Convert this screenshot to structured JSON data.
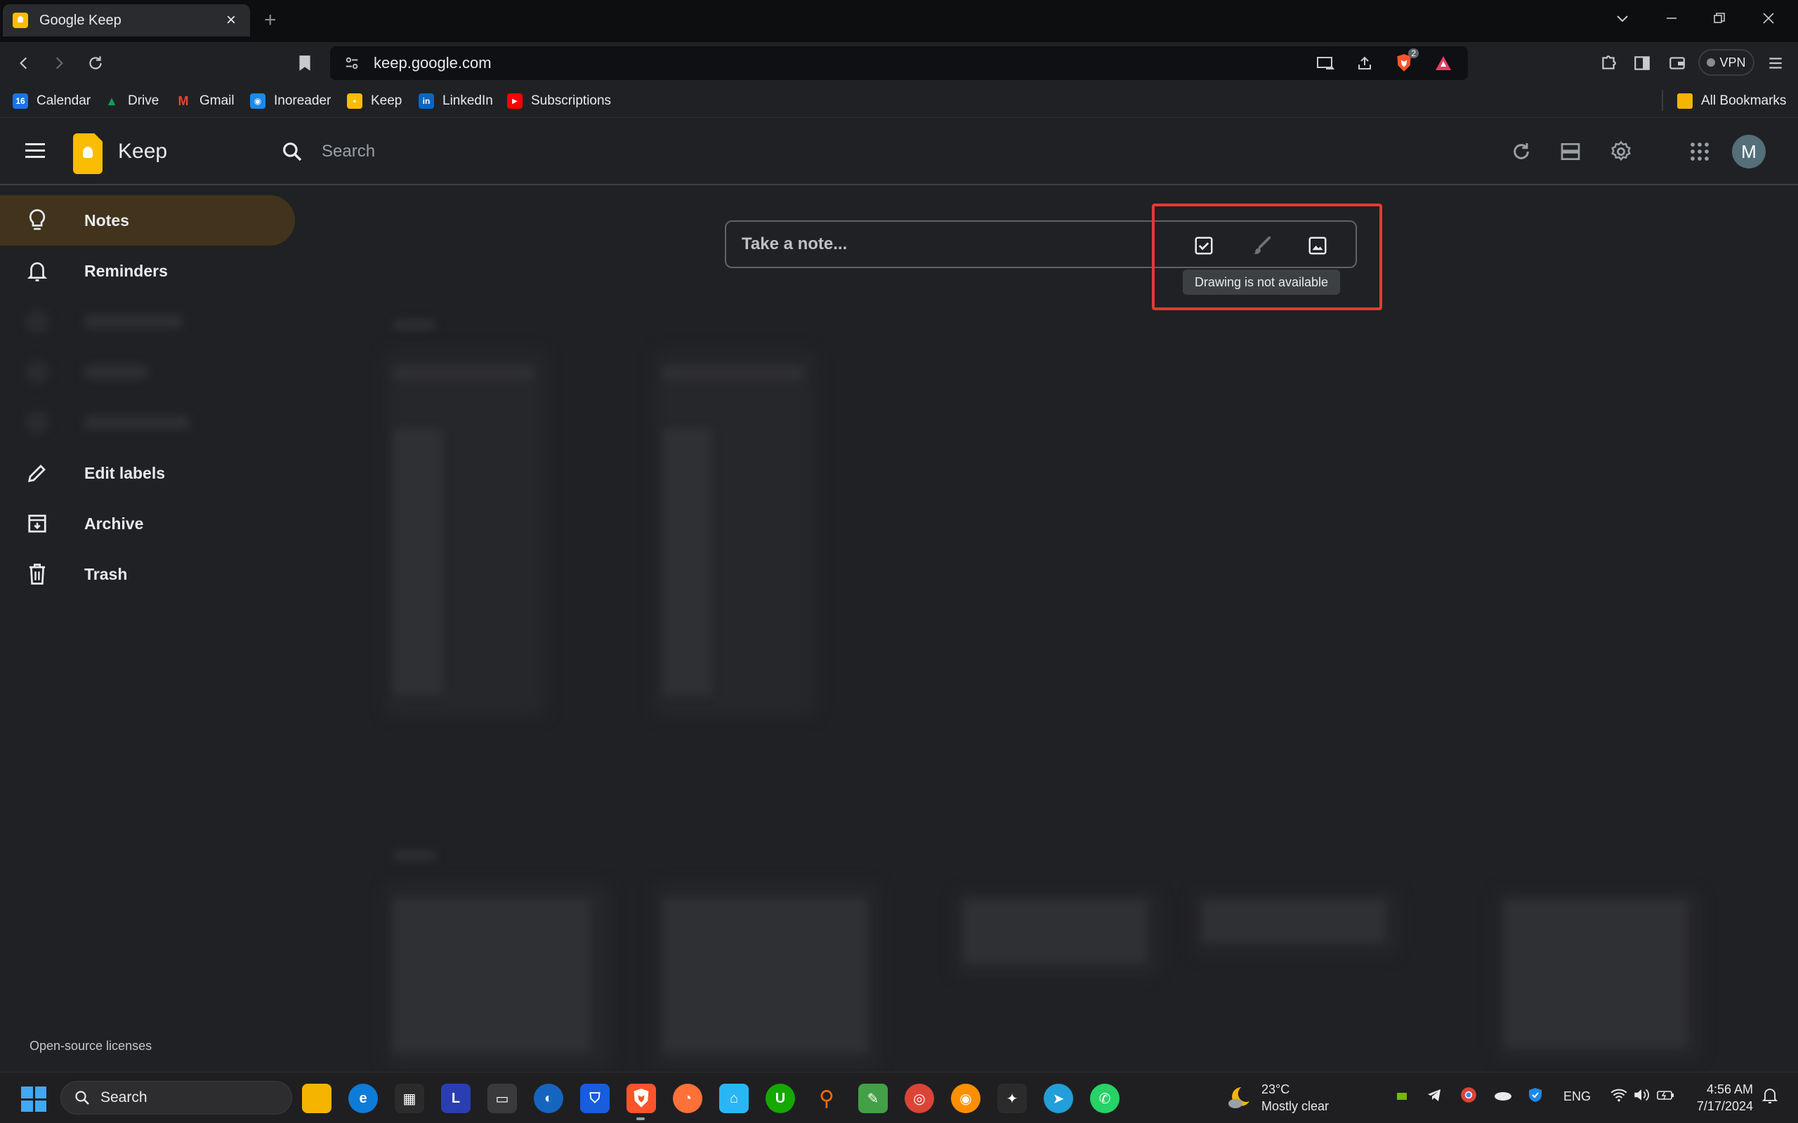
{
  "browser": {
    "tab": {
      "title": "Google Keep",
      "close": "×"
    },
    "new_tab": "+",
    "url": "keep.google.com",
    "vpn_label": "VPN",
    "shield_badge": "2",
    "bookmarks": [
      {
        "label": "Calendar",
        "icon": "calendar-icon",
        "color": "#1a73e8",
        "glyph": "16"
      },
      {
        "label": "Drive",
        "icon": "drive-icon",
        "color": "#0f9d58",
        "glyph": "▲"
      },
      {
        "label": "Gmail",
        "icon": "gmail-icon",
        "color": "#ea4335",
        "glyph": "M"
      },
      {
        "label": "Inoreader",
        "icon": "inoreader-icon",
        "color": "#1e88e5",
        "glyph": "◉"
      },
      {
        "label": "Keep",
        "icon": "keep-icon",
        "color": "#fbbc04",
        "glyph": "•"
      },
      {
        "label": "LinkedIn",
        "icon": "linkedin-icon",
        "color": "#0a66c2",
        "glyph": "in"
      },
      {
        "label": "Subscriptions",
        "icon": "youtube-icon",
        "color": "#ff0000",
        "glyph": "▶"
      }
    ],
    "all_bookmarks": "All Bookmarks"
  },
  "keep": {
    "app_name": "Keep",
    "search_placeholder": "Search",
    "avatar_initial": "M",
    "accent": "#fbbc04",
    "sidebar": {
      "notes": "Notes",
      "reminders": "Reminders",
      "edit_labels": "Edit labels",
      "archive": "Archive",
      "trash": "Trash",
      "open_source": "Open-source licenses"
    },
    "composer": {
      "placeholder": "Take a note...",
      "tooltip": "Drawing is not available"
    }
  },
  "taskbar": {
    "search": "Search",
    "weather_temp": "23°C",
    "weather_desc": "Mostly clear",
    "language": "ENG",
    "time": "4:56 AM",
    "date": "7/17/2024",
    "apps": [
      {
        "name": "file-explorer",
        "color": "#f4b400",
        "glyph": ""
      },
      {
        "name": "edge",
        "color": "#0f7bd8",
        "glyph": "e"
      },
      {
        "name": "ms-store",
        "color": "#2b2b2b",
        "glyph": "▦"
      },
      {
        "name": "app-l",
        "color": "#2a3eb1",
        "glyph": "L"
      },
      {
        "name": "app-laptop",
        "color": "#3a3a3d",
        "glyph": "▭"
      },
      {
        "name": "app-blue",
        "color": "#1565c0",
        "glyph": "◐"
      },
      {
        "name": "bitwarden",
        "color": "#175ddc",
        "glyph": "⛉"
      },
      {
        "name": "brave",
        "color": "#fb542b",
        "glyph": "🦁"
      },
      {
        "name": "firefox",
        "color": "#ff7139",
        "glyph": "◔"
      },
      {
        "name": "app-cyan",
        "color": "#29b6f6",
        "glyph": "⌂"
      },
      {
        "name": "upwork",
        "color": "#14a800",
        "glyph": "U"
      },
      {
        "name": "search-app",
        "color": "#ff6d00",
        "glyph": "⚲"
      },
      {
        "name": "app-paint",
        "color": "#43a047",
        "glyph": "✎"
      },
      {
        "name": "chrome",
        "color": "#db4437",
        "glyph": "◎"
      },
      {
        "name": "app-eye",
        "color": "#ff8f00",
        "glyph": "◉"
      },
      {
        "name": "app-fox",
        "color": "#2b2b2b",
        "glyph": "✦"
      },
      {
        "name": "telegram",
        "color": "#229ed9",
        "glyph": "➤"
      },
      {
        "name": "whatsapp",
        "color": "#25d366",
        "glyph": "✆"
      }
    ]
  }
}
